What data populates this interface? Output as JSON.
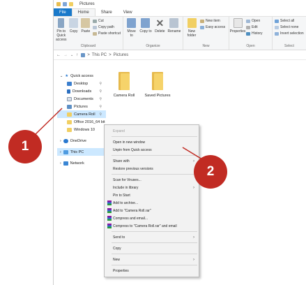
{
  "window": {
    "title": "Pictures"
  },
  "tabs": [
    "File",
    "Home",
    "Share",
    "View"
  ],
  "ribbon": {
    "clipboard": {
      "pin": "Pin to Quick access",
      "copy": "Copy",
      "paste": "Paste",
      "cut": "Cut",
      "copy_path": "Copy path",
      "paste_shortcut": "Paste shortcut",
      "label": "Clipboard"
    },
    "organize": {
      "move_to": "Move to",
      "copy_to": "Copy to",
      "delete": "Delete",
      "rename": "Rename",
      "label": "Organize"
    },
    "new": {
      "new_folder": "New folder",
      "new_item": "New item",
      "easy_access": "Easy access",
      "label": "New"
    },
    "open": {
      "properties": "Properties",
      "open": "Open",
      "edit": "Edit",
      "history": "History",
      "label": "Open"
    },
    "select": {
      "select_all": "Select all",
      "select_none": "Select none",
      "invert": "Invert selection",
      "label": "Select"
    }
  },
  "address": {
    "root": "This PC",
    "sep": ">",
    "current": "Pictures"
  },
  "nav": {
    "quick_access": "Quick access",
    "pinned": [
      "Desktop",
      "Downloads",
      "Documents",
      "Pictures",
      "Camera Roll"
    ],
    "recent": [
      "Office 2016_64 bit",
      "Windows 10"
    ],
    "onedrive": "OneDrive",
    "this_pc": "This PC",
    "network": "Network"
  },
  "folders": [
    "Camera Roll",
    "Saved Pictures"
  ],
  "context_menu": {
    "expand": "Expand",
    "open_new_window": "Open in new window",
    "unpin": "Unpin from Quick access",
    "share_with": "Share with",
    "restore": "Restore previous versions",
    "scan": "Scan for Viruses...",
    "include": "Include in library",
    "pin_start": "Pin to Start",
    "add_archive": "Add to archive...",
    "add_rar": "Add to \"Camera Roll.rar\"",
    "compress_email": "Compress and email...",
    "compress_rar_email": "Compress to \"Camera Roll.rar\" and email",
    "send_to": "Send to",
    "copy": "Copy",
    "new": "New",
    "properties": "Properties"
  },
  "callouts": {
    "one": "1",
    "two": "2"
  },
  "colors": {
    "accent": "#1979ca",
    "callout": "#c12b23",
    "folder": "#f6d36a",
    "selection": "#cce8ff"
  }
}
